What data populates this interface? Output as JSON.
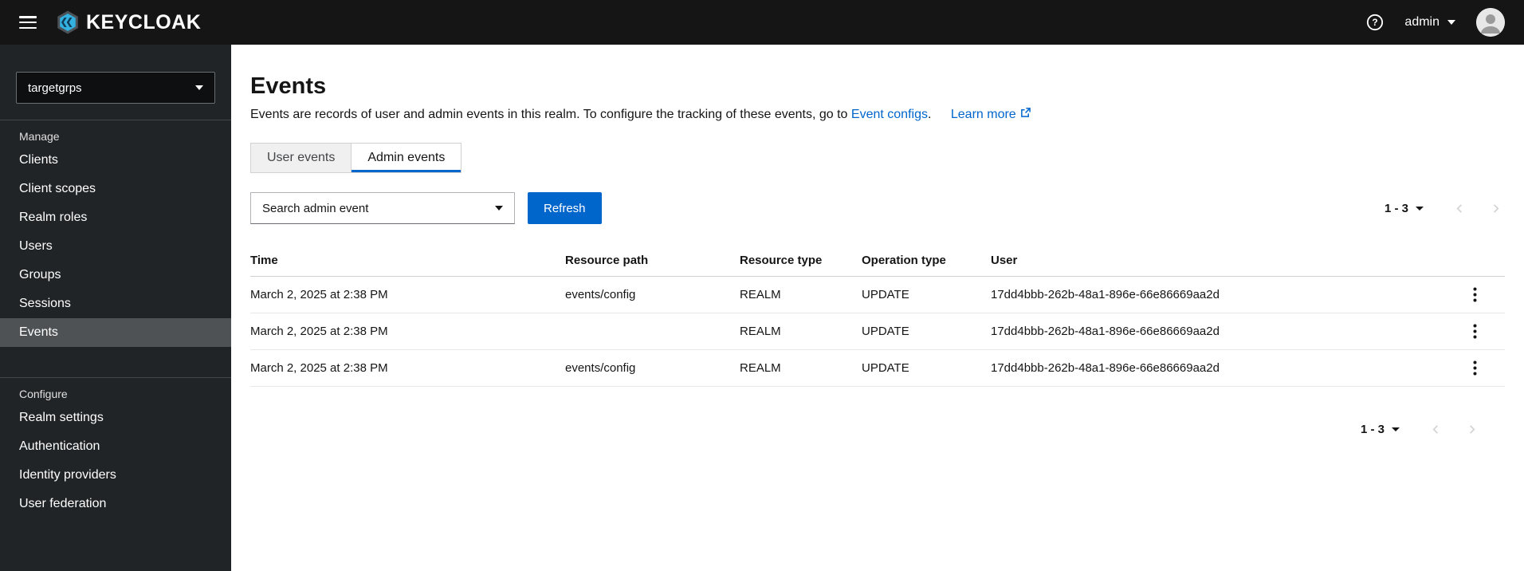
{
  "masthead": {
    "brand": "KEYCLOAK",
    "username": "admin"
  },
  "sidebar": {
    "realm": "targetgrps",
    "manage": {
      "label": "Manage",
      "items": [
        "Clients",
        "Client scopes",
        "Realm roles",
        "Users",
        "Groups",
        "Sessions",
        "Events"
      ]
    },
    "configure": {
      "label": "Configure",
      "items": [
        "Realm settings",
        "Authentication",
        "Identity providers",
        "User federation"
      ]
    },
    "active_item": "Events"
  },
  "page": {
    "title": "Events",
    "description": "Events are records of user and admin events in this realm. To configure the tracking of these events, go to",
    "event_configs_link": "Event configs",
    "after_link": ".",
    "learn_more_link": "Learn more",
    "tabs": {
      "user_events": "User events",
      "admin_events": "Admin events"
    },
    "active_tab": "Admin events"
  },
  "toolbar": {
    "search_placeholder": "Search admin event",
    "refresh_label": "Refresh",
    "pagination_range": "1 - 3"
  },
  "table": {
    "columns": [
      "Time",
      "Resource path",
      "Resource type",
      "Operation type",
      "User"
    ],
    "rows": [
      {
        "time": "March 2, 2025 at 2:38 PM",
        "resource_path": "events/config",
        "resource_type": "REALM",
        "operation_type": "UPDATE",
        "user": "17dd4bbb-262b-48a1-896e-66e86669aa2d"
      },
      {
        "time": "March 2, 2025 at 2:38 PM",
        "resource_path": "",
        "resource_type": "REALM",
        "operation_type": "UPDATE",
        "user": "17dd4bbb-262b-48a1-896e-66e86669aa2d"
      },
      {
        "time": "March 2, 2025 at 2:38 PM",
        "resource_path": "events/config",
        "resource_type": "REALM",
        "operation_type": "UPDATE",
        "user": "17dd4bbb-262b-48a1-896e-66e86669aa2d"
      }
    ]
  },
  "pagination_bottom": {
    "range": "1 - 3"
  },
  "colors": {
    "accent": "#0066cc",
    "masthead_bg": "#151515",
    "sidebar_bg": "#212427",
    "nav_active_bg": "#4f5255"
  }
}
